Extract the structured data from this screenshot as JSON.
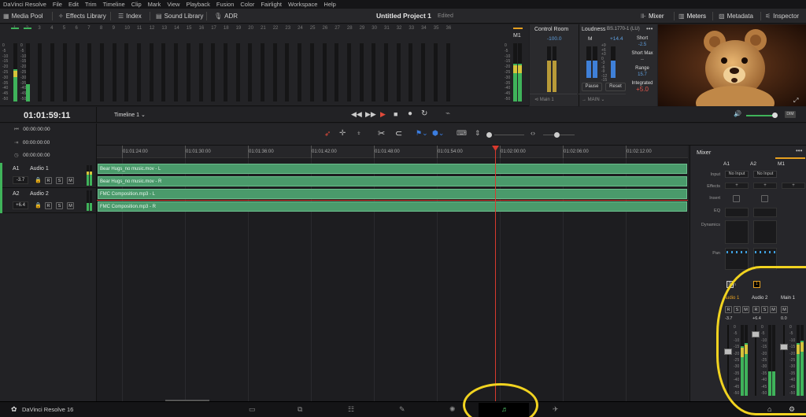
{
  "menu": [
    "DaVinci Resolve",
    "File",
    "Edit",
    "Trim",
    "Timeline",
    "Clip",
    "Mark",
    "View",
    "Playback",
    "Fusion",
    "Color",
    "Fairlight",
    "Workspace",
    "Help"
  ],
  "toolbar": {
    "left": [
      "Media Pool",
      "Effects Library",
      "Index",
      "Sound Library",
      "ADR"
    ],
    "project_title": "Untitled Project 1",
    "edited": "Edited",
    "right": [
      "Mixer",
      "Meters",
      "Metadata",
      "Inspector"
    ]
  },
  "meters": {
    "channel_numbers": [
      "1",
      "2",
      "3",
      "4",
      "5",
      "6",
      "7",
      "8",
      "9",
      "10",
      "11",
      "12",
      "13",
      "14",
      "15",
      "16",
      "17",
      "18",
      "19",
      "20",
      "21",
      "22",
      "23",
      "24",
      "25",
      "26",
      "27",
      "28",
      "29",
      "30",
      "31",
      "32",
      "33",
      "34",
      "35",
      "36"
    ],
    "m1_label": "M1",
    "scale": [
      "0",
      "-5",
      "-10",
      "-15",
      "-20",
      "-25",
      "-30",
      "-35",
      "-40",
      "-45",
      "-50"
    ],
    "a1_level": 0.55,
    "a2_level": 0.3,
    "m1_level": 0.65
  },
  "control_room": {
    "title": "Control Room",
    "value": "-100.0",
    "main_label": "Main 1",
    "main_out": "MAIN"
  },
  "loudness": {
    "title": "Loudness",
    "standard": "BS.1770-1 (LU)",
    "m_label": "M",
    "m_value": "+14.4",
    "short": "Short",
    "short_value": "-2.5",
    "short_max": "Short Max",
    "short_max_value": "--",
    "range": "Range",
    "range_value": "15.7",
    "integrated": "Integrated",
    "integrated_value": "+5.0",
    "pause": "Pause",
    "reset": "Reset",
    "scale": [
      "+9",
      "+6",
      "+3",
      "0",
      "-3",
      "-6",
      "-9",
      "-12",
      "-15"
    ]
  },
  "transport": {
    "timecode": "01:01:59:11",
    "timeline_name": "Timeline 1"
  },
  "timecodes": [
    "00:00:00:00",
    "00:00:00:00",
    "00:00:00:00"
  ],
  "ruler": [
    "01:01:24:00",
    "01:01:30:00",
    "01:01:36:00",
    "01:01:42:00",
    "01:01:48:00",
    "01:01:54:00",
    "01:02:00:00",
    "01:02:06:00",
    "01:02:12:00"
  ],
  "tracks": [
    {
      "id": "A1",
      "name": "Audio 1",
      "level": "-3.7"
    },
    {
      "id": "A2",
      "name": "Audio 2",
      "level": "+6.4"
    }
  ],
  "track_buttons": [
    "R",
    "S",
    "M"
  ],
  "clips": [
    "Bear Hugs_no music.mov - L",
    "Bear Hugs_no music.mov - R",
    "FMC Composition.mp3 - L",
    "FMC Composition.mp3 - R"
  ],
  "mixer": {
    "title": "Mixer",
    "columns": [
      "A1",
      "A2",
      "M1"
    ],
    "rows": [
      "Input",
      "Effects",
      "Insert",
      "EQ",
      "Dynamics",
      "Pan",
      "Main"
    ],
    "no_input": "No Input",
    "main_value": "1",
    "channel_names": [
      "Audio 1",
      "Audio 2",
      "Main 1"
    ],
    "fader_values": [
      "-3.7",
      "+6.4",
      "0.0"
    ],
    "scale": [
      "0",
      "-5",
      "-10",
      "-15",
      "-20",
      "-25",
      "-30",
      "-35",
      "-40",
      "-45",
      "-50"
    ]
  },
  "statusbar": {
    "app_name": "DaVinci Resolve 16"
  },
  "colors": {
    "clip_green": "#4a9a6b",
    "playhead_red": "#d83a2e",
    "annotation_yellow": "#f1d320",
    "accent_orange": "#e6a020"
  }
}
